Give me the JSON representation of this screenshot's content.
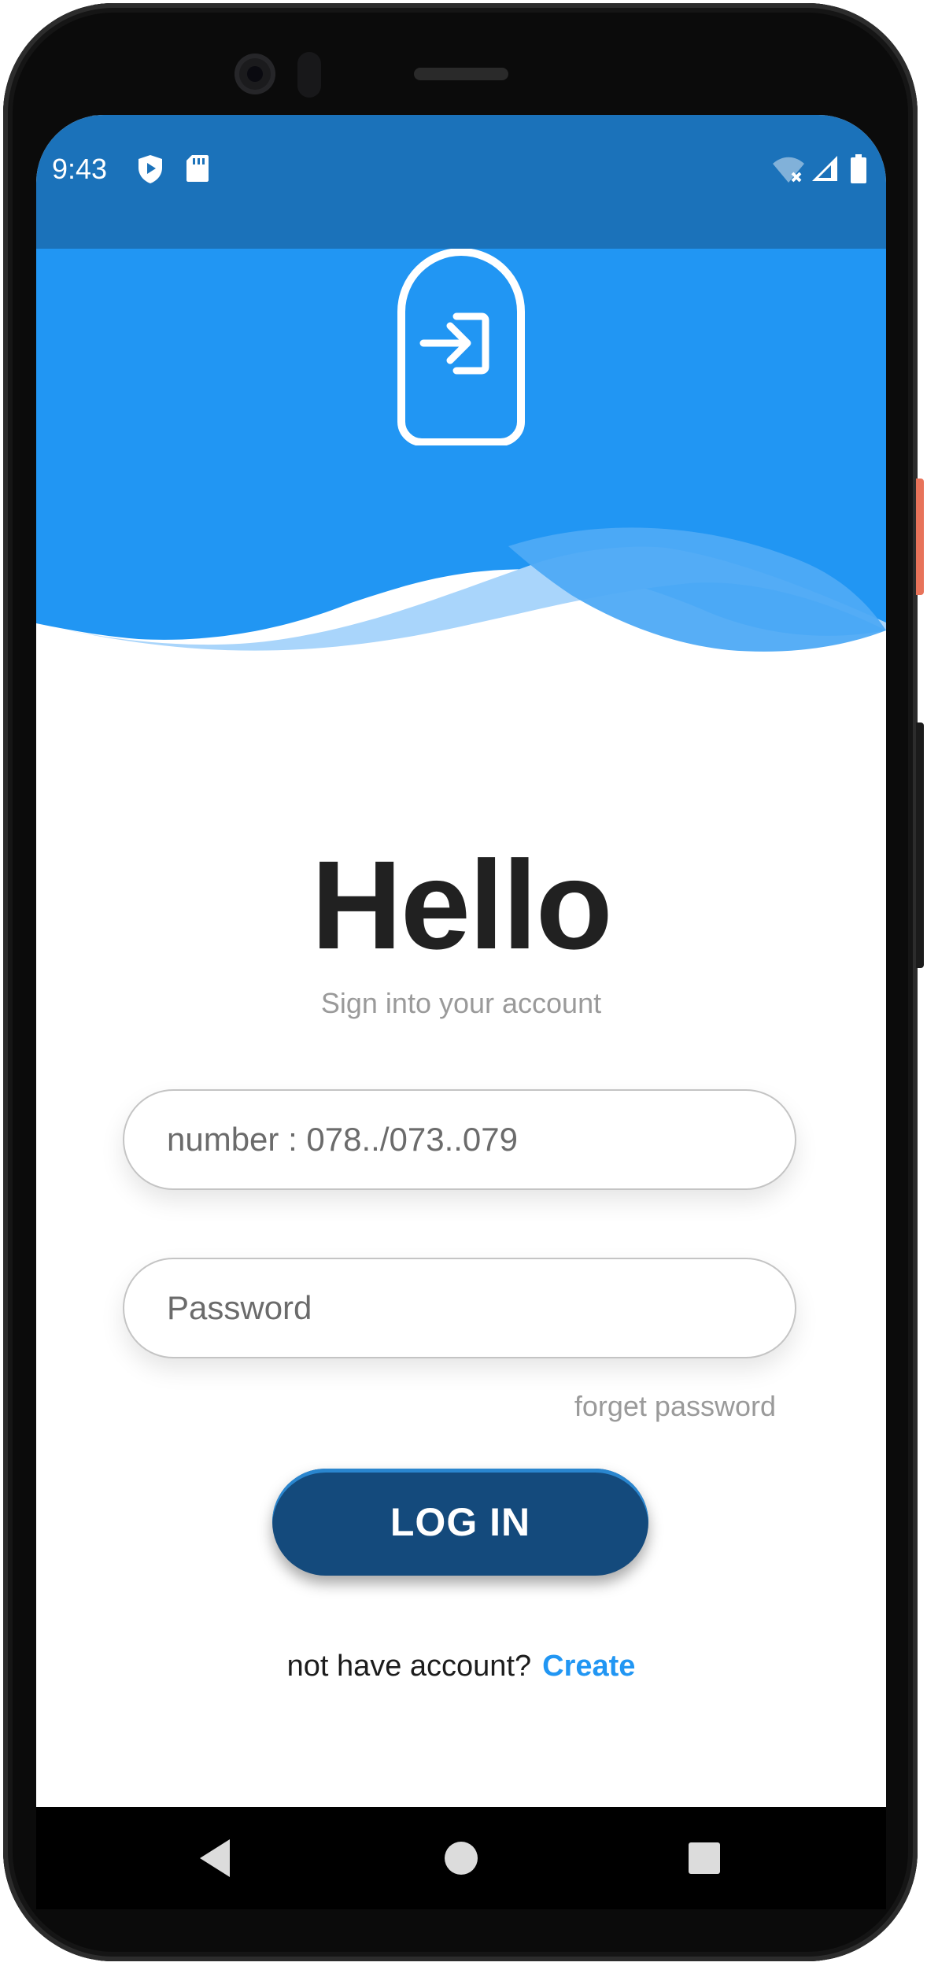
{
  "status_bar": {
    "time": "9:43",
    "left_icons": [
      "shield-play-icon",
      "sd-card-icon"
    ],
    "right_icons": [
      "wifi-off-icon",
      "cell-signal-icon",
      "battery-icon"
    ],
    "color": "#1b72ba"
  },
  "header": {
    "icon": "login-arrow-icon",
    "color": "#2196f3"
  },
  "main": {
    "title": "Hello",
    "subtitle": "Sign into your account",
    "phone_placeholder": "number : 078../073..079",
    "password_placeholder": "Password",
    "forget_label": "forget password",
    "login_label": "LOG IN",
    "signup_prompt": "not have account?",
    "signup_link": "Create"
  },
  "nav_bar": {
    "items": [
      "back-icon",
      "home-icon",
      "recents-icon"
    ]
  },
  "colors": {
    "accent": "#2196f3",
    "button": "#144a7c",
    "title": "#212121",
    "muted": "#9a9a9a"
  }
}
